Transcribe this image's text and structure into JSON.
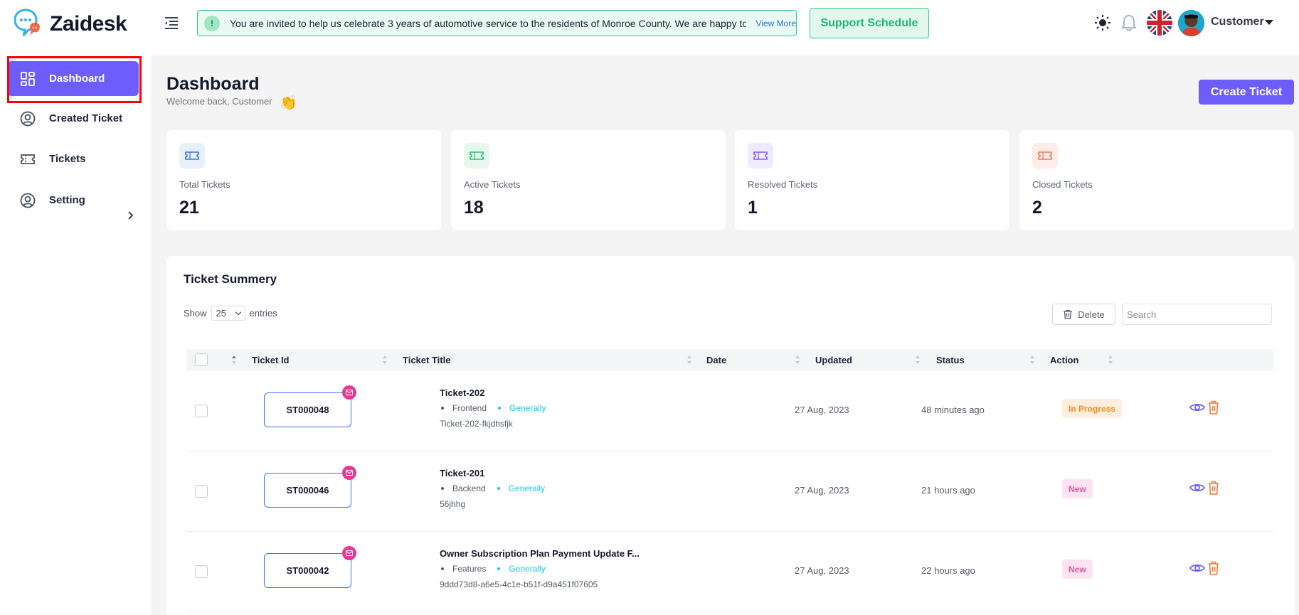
{
  "header": {
    "logo_text": "Zaidesk",
    "notice_icon": "!",
    "notice_text": "You are invited to help us celebrate 3 years of automotive service to the residents of Monroe County. We are happy to be",
    "notice_link": "View More",
    "support_button": "Support Schedule",
    "user_name": "Customer"
  },
  "sidebar": {
    "items": [
      {
        "label": "Dashboard",
        "icon": "grid-icon"
      },
      {
        "label": "Created Ticket",
        "icon": "user-circle-icon"
      },
      {
        "label": "Tickets",
        "icon": "ticket-icon"
      },
      {
        "label": "Setting",
        "icon": "user-circle-icon"
      }
    ]
  },
  "page": {
    "title": "Dashboard",
    "subtitle": "Welcome back, Customer",
    "wave_emoji": "👏",
    "create_button": "Create Ticket"
  },
  "stats": [
    {
      "label": "Total Tickets",
      "value": "21",
      "color": "#3a75e8",
      "bg": "#e9f0fd"
    },
    {
      "label": "Active Tickets",
      "value": "18",
      "color": "#2fbf71",
      "bg": "#e6f8ee"
    },
    {
      "label": "Resolved Tickets",
      "value": "1",
      "color": "#8a5cf6",
      "bg": "#f0eafe"
    },
    {
      "label": "Closed Tickets",
      "value": "2",
      "color": "#f07a5c",
      "bg": "#fdece8"
    }
  ],
  "summary": {
    "title": "Ticket Summery",
    "show_label": "Show",
    "entries_value": "25",
    "entries_label": "entries",
    "delete_button": "Delete",
    "search_placeholder": "Search",
    "columns": [
      "Ticket Id",
      "Ticket Title",
      "Date",
      "Updated",
      "Status",
      "Action"
    ],
    "rows": [
      {
        "id": "ST000048",
        "title": "Ticket-202",
        "category": "Frontend",
        "tag": "Generally",
        "sub": "Ticket-202-fkjdhsfjk",
        "date": "27 Aug, 2023",
        "updated": "48 minutes ago",
        "status": "In Progress",
        "status_type": "progress"
      },
      {
        "id": "ST000046",
        "title": "Ticket-201",
        "category": "Backend",
        "tag": "Generally",
        "sub": "56jhhg",
        "date": "27 Aug, 2023",
        "updated": "21 hours ago",
        "status": "New",
        "status_type": "new"
      },
      {
        "id": "ST000042",
        "title": "Owner Subscription Plan Payment Update F...",
        "category": "Features",
        "tag": "Generally",
        "sub": "9ddd73d8-a6e5-4c1e-b51f-d9a451f07605",
        "date": "27 Aug, 2023",
        "updated": "22 hours ago",
        "status": "New",
        "status_type": "new"
      }
    ]
  },
  "colors": {
    "accent": "#6c5dfc",
    "notice_border": "#3cc58a",
    "ticket_id_border": "#3a75e8",
    "mail_badge": "#e63a8e",
    "highlight": "#ff0000"
  }
}
